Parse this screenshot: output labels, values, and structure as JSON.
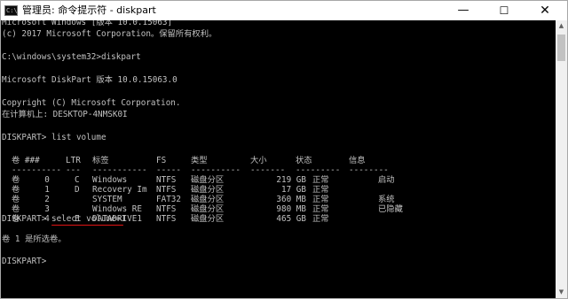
{
  "window": {
    "title": "管理员: 命令提示符 - diskpart",
    "icon": "cmd-icon",
    "icon_glyph": "C:\\",
    "minimize_glyph": "—",
    "maximize_glyph": "☐",
    "close_glyph": "✕"
  },
  "console": {
    "line1": "Microsoft Windows [版本 10.0.15063]",
    "line2": "(c) 2017 Microsoft Corporation。保留所有权利。",
    "line3": "C:\\windows\\system32>diskpart",
    "line4": "Microsoft DiskPart 版本 10.0.15063.0",
    "line5": "Copyright (C) Microsoft Corporation.",
    "line6": "在计算机上: DESKTOP-4NMSK0I",
    "line7": "DISKPART> list volume",
    "line8_prompt": "DISKPART> ",
    "line8_cmd": "select volume=1",
    "line9": "卷 1 是所选卷。",
    "line10": "DISKPART>"
  },
  "volume_table": {
    "headers": {
      "vol": "卷 ###",
      "ltr": "LTR",
      "label": "标签",
      "fs": "FS",
      "type": "类型",
      "size": "大小",
      "status": "状态",
      "info": "信息"
    },
    "separators": {
      "vol": "----------",
      "ltr": "---",
      "label": "-----------",
      "fs": "-----",
      "type": "----------",
      "size": "-------",
      "status": "---------",
      "info": "--------"
    },
    "rows": [
      {
        "vol": "卷     0",
        "ltr": "C",
        "label": "Windows",
        "fs": "NTFS",
        "type": "磁盘分区",
        "size": "219 GB",
        "status": "正常",
        "info": "启动"
      },
      {
        "vol": "卷     1",
        "ltr": "D",
        "label": "Recovery Im",
        "fs": "NTFS",
        "type": "磁盘分区",
        "size": "17 GB",
        "status": "正常",
        "info": ""
      },
      {
        "vol": "卷     2",
        "ltr": "",
        "label": "SYSTEM",
        "fs": "FAT32",
        "type": "磁盘分区",
        "size": "360 MB",
        "status": "正常",
        "info": "系统"
      },
      {
        "vol": "卷     3",
        "ltr": "",
        "label": "Windows RE",
        "fs": "NTFS",
        "type": "磁盘分区",
        "size": "980 MB",
        "status": "正常",
        "info": "已隐藏"
      },
      {
        "vol": "卷     4",
        "ltr": "E",
        "label": "DATADRIVE1",
        "fs": "NTFS",
        "type": "磁盘分区",
        "size": "465 GB",
        "status": "正常",
        "info": ""
      }
    ]
  },
  "colors": {
    "console_bg": "#000000",
    "console_text": "#c0c0c0",
    "highlight_underline": "#e11414"
  },
  "scrollbar": {
    "up_glyph": "▲",
    "down_glyph": "▼"
  }
}
